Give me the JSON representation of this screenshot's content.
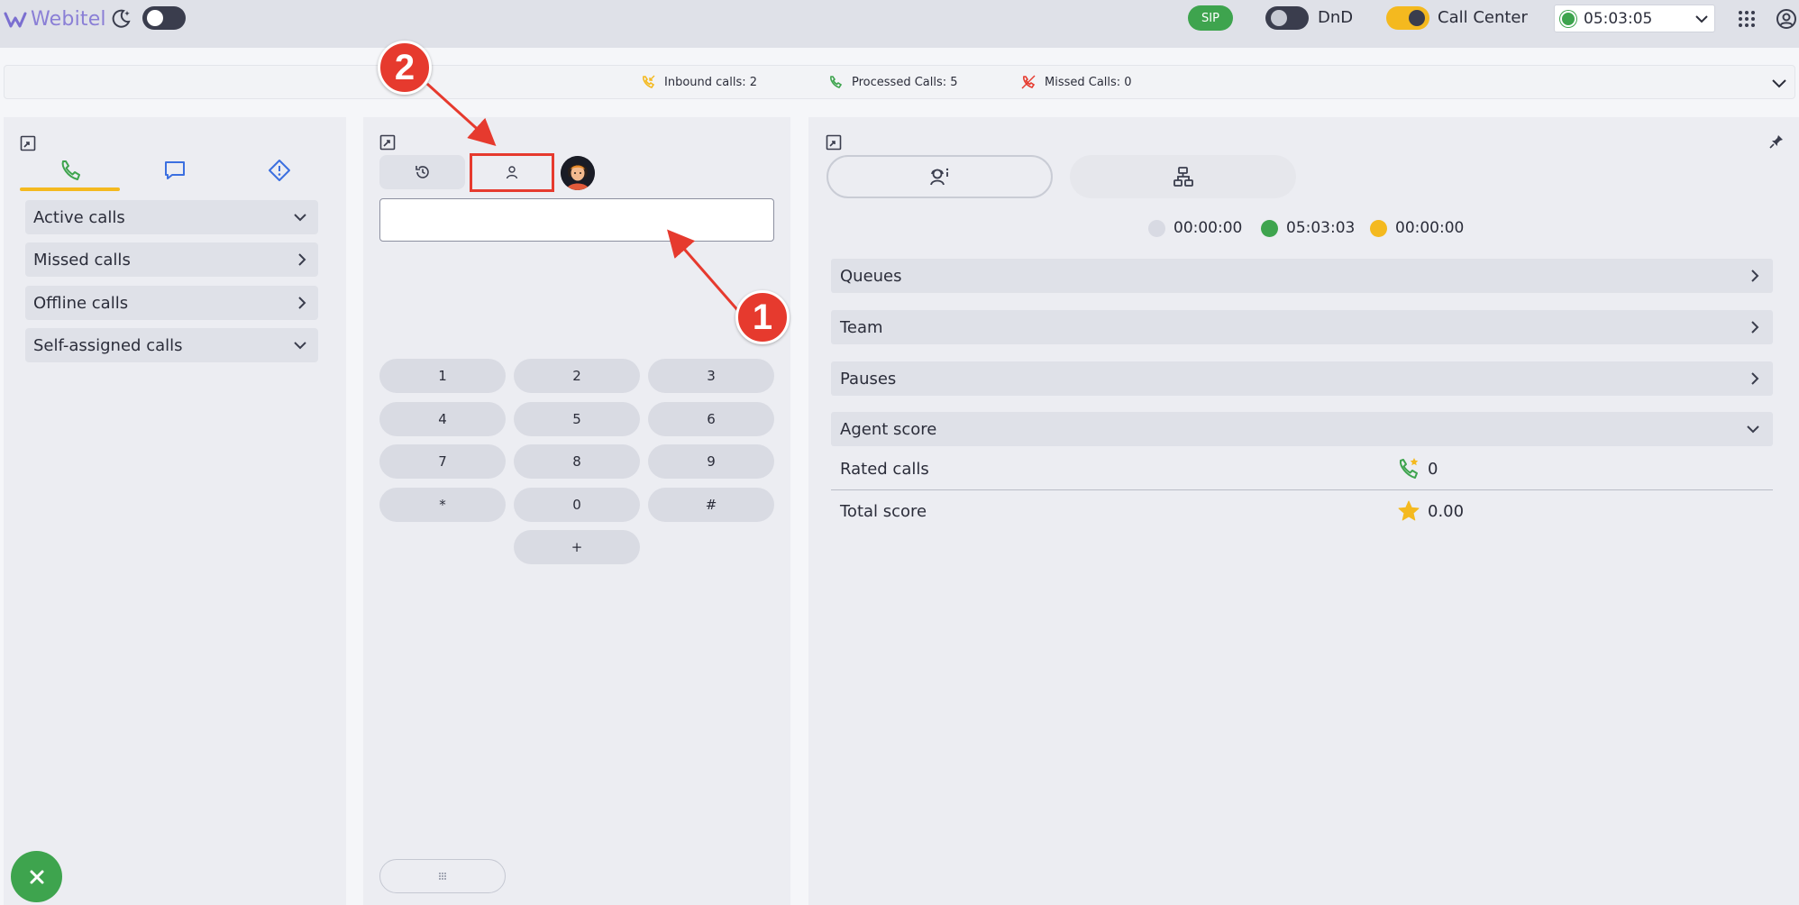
{
  "header": {
    "logo_text": "Webitel",
    "sip_label": "SIP",
    "dnd_label": "DnD",
    "call_center_label": "Call Center",
    "status_time": "05:03:05"
  },
  "stats": {
    "inbound": "Inbound calls: 2",
    "processed": "Processed Calls: 5",
    "missed": "Missed Calls: 0"
  },
  "left_panel": {
    "items": [
      {
        "label": "Active calls"
      },
      {
        "label": "Missed calls"
      },
      {
        "label": "Offline calls"
      },
      {
        "label": "Self-assigned calls"
      }
    ]
  },
  "mid_panel": {
    "search_value": "",
    "keys": [
      "1",
      "2",
      "3",
      "4",
      "5",
      "6",
      "7",
      "8",
      "9",
      "*",
      "0",
      "#",
      "+"
    ]
  },
  "right_panel": {
    "timers": [
      "00:00:00",
      "05:03:03",
      "00:00:00"
    ],
    "sections": [
      {
        "label": "Queues"
      },
      {
        "label": "Team"
      },
      {
        "label": "Pauses"
      },
      {
        "label": "Agent score"
      }
    ],
    "score": {
      "rated_label": "Rated calls",
      "rated_value": "0",
      "total_label": "Total score",
      "total_value": "0.00"
    }
  },
  "annotations": {
    "marker_1": "1",
    "marker_2": "2"
  },
  "colors": {
    "accent_green": "#3ea44e",
    "accent_yellow": "#f4b91f",
    "annotation_red": "#e63a2e",
    "chat_blue": "#3b6fe0"
  }
}
